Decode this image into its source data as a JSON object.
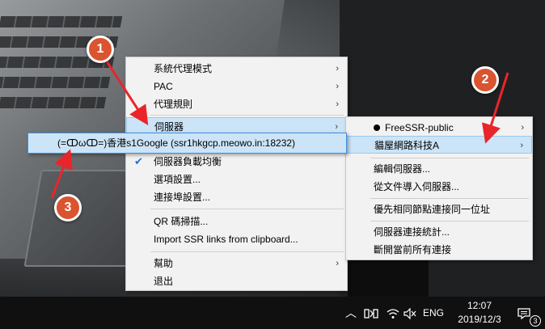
{
  "context_menu": {
    "items": [
      {
        "label": "系統代理模式",
        "submenu": true
      },
      {
        "label": "PAC",
        "submenu": true
      },
      {
        "label": "代理規則",
        "submenu": true
      },
      {
        "label": "伺服器",
        "submenu": true,
        "highlighted": true
      },
      {
        "label": "伺服器負載均衡",
        "checked": true
      },
      {
        "label": "選項設置..."
      },
      {
        "label": "連接埠設置..."
      },
      {
        "label": "QR 碼掃描..."
      },
      {
        "label": "Import SSR links from clipboard..."
      },
      {
        "label": "幫助",
        "submenu": true
      },
      {
        "label": "退出"
      }
    ]
  },
  "server_submenu": {
    "items": [
      {
        "label": "FreeSSR-public",
        "submenu": true,
        "selected": true
      },
      {
        "label": "貓屋網路科技A",
        "submenu": true,
        "highlighted": true
      },
      {
        "label": "編輯伺服器..."
      },
      {
        "label": "從文件導入伺服器..."
      },
      {
        "label": "優先相同節點連接同一位址"
      },
      {
        "label": "伺服器連接統計..."
      },
      {
        "label": "斷開當前所有連接"
      }
    ]
  },
  "server_entry": {
    "label": "(=ↀωↀ=)香港s1Google (ssr1hkgcp.meowo.in:18232)"
  },
  "annotations": {
    "badge1": "1",
    "badge2": "2",
    "badge3": "3"
  },
  "taskbar": {
    "language": "ENG",
    "time": "12:07",
    "date": "2019/12/3",
    "notification_count": "3",
    "icons": [
      "chevron-up-icon",
      "ssr-tray-icon",
      "wifi-icon",
      "volume-muted-icon",
      "notification-icon"
    ]
  },
  "colors": {
    "highlight": "#cce4f7",
    "badge": "#d9542f",
    "arrow": "#e8262a",
    "taskbar": "#101010"
  }
}
